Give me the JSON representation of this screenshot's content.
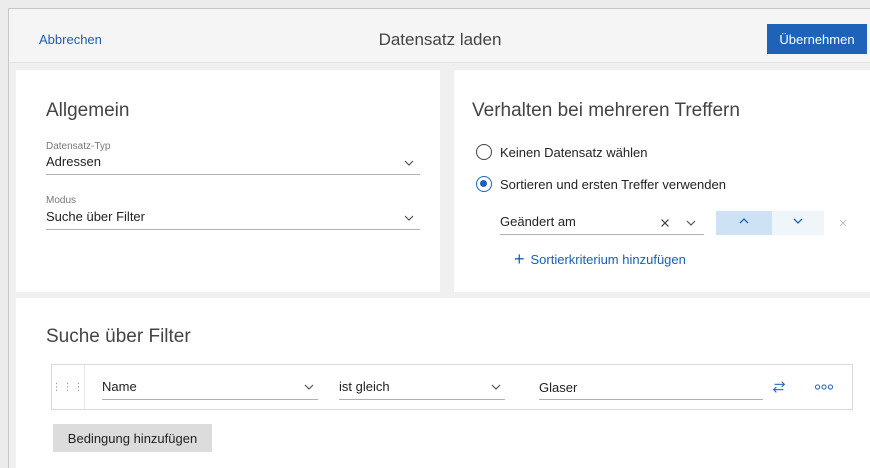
{
  "header": {
    "cancel_label": "Abbrechen",
    "title": "Datensatz laden",
    "apply_label": "Übernehmen"
  },
  "general": {
    "title": "Allgemein",
    "record_type_label": "Datensatz-Typ",
    "record_type_value": "Adressen",
    "mode_label": "Modus",
    "mode_value": "Suche über Filter"
  },
  "multiple_hits": {
    "title": "Verhalten bei mehreren Treffern",
    "options": [
      {
        "label": "Keinen Datensatz wählen",
        "selected": false
      },
      {
        "label": "Sortieren und ersten Treffer verwenden",
        "selected": true
      }
    ],
    "sort_field_value": "Geändert am",
    "add_sort_label": "Sortierkriterium hinzufügen"
  },
  "filter": {
    "title": "Suche über Filter",
    "condition": {
      "field_value": "Name",
      "operator_value": "ist gleich",
      "value": "Glaser"
    },
    "add_condition_label": "Bedingung hinzufügen"
  },
  "icons": {
    "chevron": "chevron-down-icon",
    "clear": "close-icon",
    "sort_ascending": "chevron-up-icon",
    "sort_descending": "chevron-down-icon",
    "remove": "close-icon",
    "drag": "drag-handle-icon",
    "switch": "switch-arrows-icon",
    "more": "more-options-icon",
    "plus": "plus-icon"
  },
  "colors": {
    "accent": "#1e63b8",
    "link": "#1a5fb4",
    "background": "#f0f0f0"
  }
}
